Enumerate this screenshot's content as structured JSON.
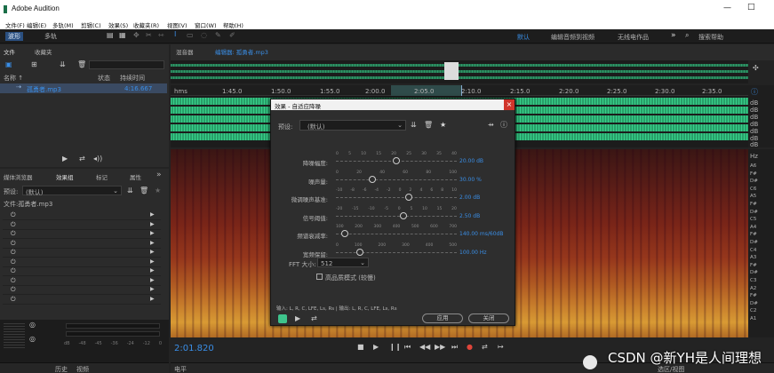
{
  "window": {
    "title": "Adobe Audition",
    "minimize": "—",
    "maximize": "□"
  },
  "menu": [
    "文件(F)",
    "编辑(E)",
    "多轨(M)",
    "剪辑(C)",
    "效果(S)",
    "收藏夹(R)",
    "视图(V)",
    "窗口(W)",
    "帮助(H)"
  ],
  "toolbar": {
    "waveform": "波形",
    "multitrack": "多轨",
    "workspace_default": "默认",
    "workspace_edit": "编辑音频到视频",
    "workspace_radio": "无线电作品",
    "more": "»",
    "search": "搜索帮助"
  },
  "files_panel": {
    "tab_files": "文件",
    "tab_favorites": "收藏夹",
    "col_name": "名称 ↑",
    "col_status": "状态",
    "col_duration": "持续时间",
    "file_name": "孤勇者.mp3",
    "file_duration": "4:16.667"
  },
  "effects_rack": {
    "tab_media": "媒体浏览器",
    "tab_rack": "效果组",
    "tab_markers": "标记",
    "tab_props": "属性",
    "more": "»",
    "preset_label": "预设:",
    "preset_value": "(默认)",
    "file_label": "文件:孤勇者.mp3",
    "slots": 10
  },
  "editor": {
    "tab_mixer": "混音器",
    "tab_editor": "编辑器: 孤勇者.mp3",
    "ruler": [
      "hms",
      "1:45.0",
      "1:50.0",
      "1:55.0",
      "2:00.0",
      "2:05.0",
      "2:10.0",
      "2:15.0",
      "2:20.0",
      "2:25.0",
      "2:30.0",
      "2:35.0"
    ],
    "db_labels": [
      "dB",
      "dB",
      "dB",
      "dB",
      "dB",
      "dB",
      "dB",
      "dB",
      "dB"
    ],
    "hz_label": "Hz",
    "notes": [
      "A6",
      "F#",
      "D#",
      "C6",
      "A5",
      "F#",
      "D#",
      "C5",
      "A4",
      "F#",
      "D#",
      "C4",
      "A3",
      "F#",
      "D#",
      "C3",
      "A2",
      "F#",
      "D#",
      "C2",
      "A1"
    ],
    "time": "2:01.820"
  },
  "bottom": {
    "level": "电平",
    "history": "历史",
    "video": "视频",
    "selection": "选区/视图",
    "db_scale": [
      "dB",
      "-48",
      "-45",
      "-36",
      "-24",
      "-12",
      "0"
    ]
  },
  "dialog": {
    "title": "效果 - 自适应降噪",
    "close": "×",
    "preset_label": "预设:",
    "preset_value": "(默认)",
    "sliders": [
      {
        "label": "降噪幅度:",
        "ticks": [
          "0",
          "5",
          "10",
          "15",
          "20",
          "25",
          "30",
          "35",
          "40"
        ],
        "value": "20.00 dB",
        "fraction": 0.5
      },
      {
        "label": "噪声量:",
        "ticks": [
          "0",
          "20",
          "40",
          "60",
          "80",
          "100"
        ],
        "value": "30.00 %",
        "fraction": 0.3
      },
      {
        "label": "微调噪声基准:",
        "ticks": [
          "-10",
          "-8",
          "-6",
          "-4",
          "-2",
          "0",
          "2",
          "4",
          "6",
          "8",
          "10"
        ],
        "value": "2.00 dB",
        "fraction": 0.6
      },
      {
        "label": "信号阈值:",
        "ticks": [
          "-20",
          "-15",
          "-10",
          "-5",
          "0",
          "5",
          "10",
          "15",
          "20"
        ],
        "value": "2.50 dB",
        "fraction": 0.56
      },
      {
        "label": "频谱衰减率:",
        "ticks": [
          "100",
          "200",
          "300",
          "400",
          "500",
          "600",
          "700"
        ],
        "value": "140.00 ms/60dB",
        "fraction": 0.07
      },
      {
        "label": "宽频保留:",
        "ticks": [
          "0",
          "100",
          "200",
          "300",
          "400",
          "500"
        ],
        "value": "100.00 Hz",
        "fraction": 0.2
      }
    ],
    "fft_label": "FFT 大小:",
    "fft_value": "512",
    "hq_label": "高品质模式 (较慢)",
    "io_text": "输入: L, R, C, LFE, Ls, Rs | 输出: L, R, C, LFE, Ls, Rs",
    "apply": "应用",
    "cancel": "关闭"
  },
  "watermark": "CSDN @新YH是人间理想"
}
